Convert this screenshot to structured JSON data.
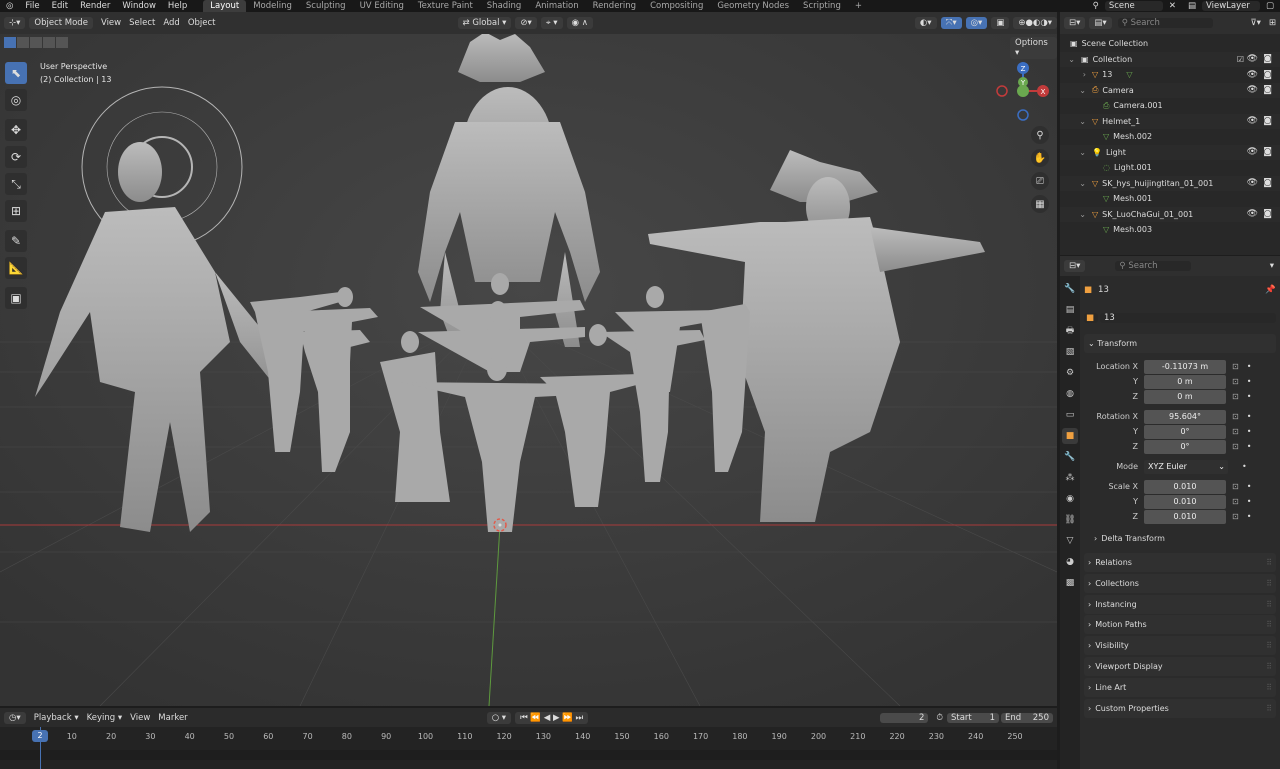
{
  "top_menu": {
    "logo": "blender-icon",
    "items": [
      "File",
      "Edit",
      "Render",
      "Window",
      "Help"
    ],
    "workspaces": [
      "Layout",
      "Modeling",
      "Sculpting",
      "UV Editing",
      "Texture Paint",
      "Shading",
      "Animation",
      "Rendering",
      "Compositing",
      "Geometry Nodes",
      "Scripting"
    ],
    "active_workspace": "Layout",
    "add_workspace": "+",
    "scene": "Scene",
    "view_layer": "ViewLayer"
  },
  "viewport": {
    "mode": "Object Mode",
    "menus": [
      "View",
      "Select",
      "Add",
      "Object"
    ],
    "transform_orientation": "Global",
    "options": "Options",
    "overlay_title": "User Perspective",
    "overlay_subtitle": "(2) Collection | 13",
    "gizmo": {
      "x": "X",
      "y": "Y",
      "z": "Z"
    }
  },
  "outliner": {
    "search_placeholder": "Search",
    "rows": [
      {
        "label": "Scene Collection",
        "icon": "collection-icon",
        "indent": 0
      },
      {
        "label": "Collection",
        "icon": "collection-icon",
        "indent": 1
      },
      {
        "label": "13",
        "icon": "mesh-object-icon",
        "indent": 2
      },
      {
        "label": "Camera",
        "icon": "camera-icon",
        "indent": 2
      },
      {
        "label": "Camera.001",
        "icon": "camera-data-icon",
        "indent": 3
      },
      {
        "label": "Helmet_1",
        "icon": "mesh-object-icon",
        "indent": 2
      },
      {
        "label": "Mesh.002",
        "icon": "mesh-data-icon",
        "indent": 3
      },
      {
        "label": "Light",
        "icon": "light-icon",
        "indent": 2
      },
      {
        "label": "Light.001",
        "icon": "light-data-icon",
        "indent": 3
      },
      {
        "label": "SK_hys_huijingtitan_01_001",
        "icon": "mesh-object-icon",
        "indent": 2
      },
      {
        "label": "Mesh.001",
        "icon": "mesh-data-icon",
        "indent": 3
      },
      {
        "label": "SK_LuoChaGui_01_001",
        "icon": "mesh-object-icon",
        "indent": 2
      },
      {
        "label": "Mesh.003",
        "icon": "mesh-data-icon",
        "indent": 3
      }
    ]
  },
  "properties": {
    "search_placeholder": "Search",
    "object_name": "13",
    "object_field": "13",
    "transform_header": "Transform",
    "location_label": "Location X",
    "location": [
      "-0.11073 m",
      "0 m",
      "0 m"
    ],
    "rotation_label": "Rotation X",
    "rotation": [
      "95.604°",
      "0°",
      "0°"
    ],
    "axis_y": "Y",
    "axis_z": "Z",
    "mode_label": "Mode",
    "mode_value": "XYZ Euler",
    "scale_label": "Scale X",
    "scale": [
      "0.010",
      "0.010",
      "0.010"
    ],
    "delta_transform": "Delta Transform",
    "sections": [
      "Relations",
      "Collections",
      "Instancing",
      "Motion Paths",
      "Visibility",
      "Viewport Display",
      "Line Art",
      "Custom Properties"
    ]
  },
  "timeline": {
    "menus": [
      "Playback",
      "Keying",
      "View",
      "Marker"
    ],
    "current_frame": "2",
    "start_label": "Start",
    "start": "1",
    "end_label": "End",
    "end": "250",
    "frame_marker": "2",
    "ticks": [
      "10",
      "20",
      "30",
      "40",
      "50",
      "60",
      "70",
      "80",
      "90",
      "100",
      "110",
      "120",
      "130",
      "140",
      "150",
      "160",
      "170",
      "180",
      "190",
      "200",
      "210",
      "220",
      "230",
      "240",
      "250"
    ]
  },
  "colors": {
    "accent": "#4772b3",
    "selection": "#334d80",
    "x_axis": "#c23b3b",
    "y_axis": "#6aa84f",
    "z_axis": "#3b6ec2",
    "object_icon": "#f0a040"
  }
}
